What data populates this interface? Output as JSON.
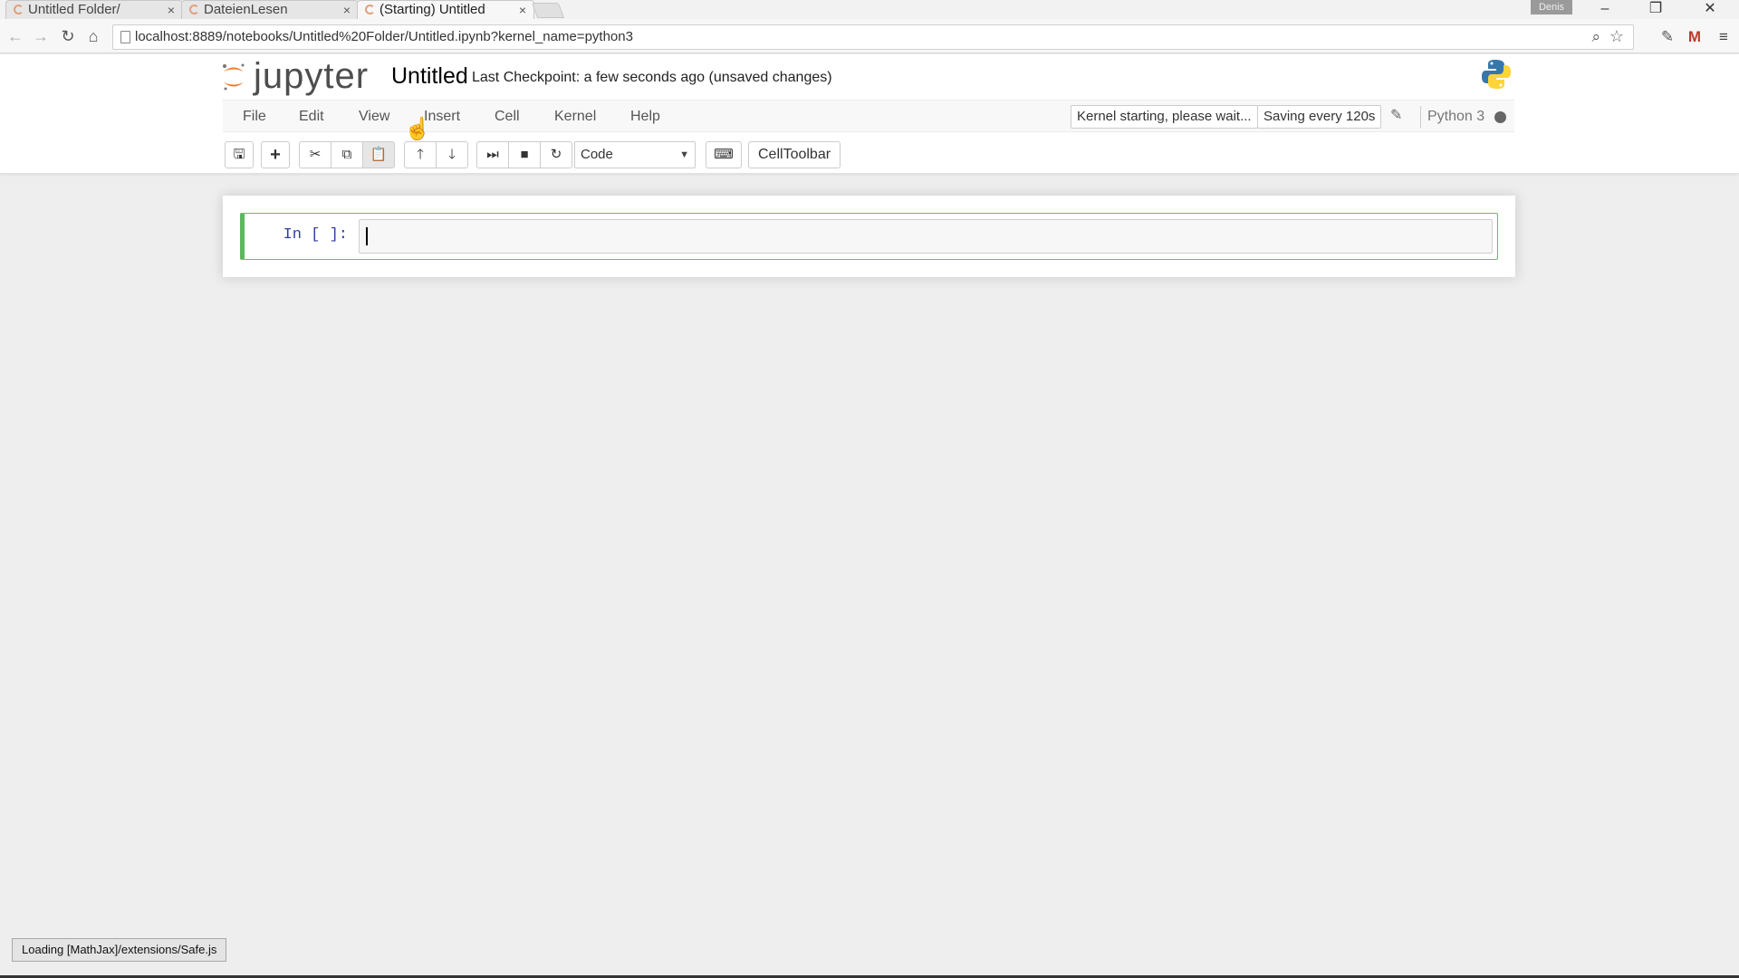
{
  "browser": {
    "tabs": [
      {
        "label": "Untitled Folder/",
        "close": "×"
      },
      {
        "label": "DateienLesen",
        "close": "×"
      },
      {
        "label": "(Starting) Untitled",
        "close": "×"
      }
    ],
    "profile": "Denis",
    "window_controls": {
      "minimize": "–",
      "restore": "❐",
      "close": "✕"
    },
    "url": "localhost:8889/notebooks/Untitled%20Folder/Untitled.ipynb?kernel_name=python3",
    "nav": {
      "back": "←",
      "forward": "→",
      "reload": "↻",
      "home": "⌂"
    }
  },
  "jupyter": {
    "logo_text": "jupyter",
    "notebook_title": "Untitled",
    "checkpoint": "Last Checkpoint: a few seconds ago (unsaved changes)",
    "menu": [
      "File",
      "Edit",
      "View",
      "Insert",
      "Cell",
      "Kernel",
      "Help"
    ],
    "kernel_status": "Kernel starting, please wait...",
    "autosave": "Saving every 120s",
    "kernel_name": "Python 3",
    "toolbar": {
      "save": "🖫",
      "insert": "+",
      "cut": "✂",
      "copy": "⧉",
      "paste": "📋",
      "move_up": "🡑",
      "move_down": "🡓",
      "run": "⏭",
      "stop": "■",
      "restart": "↻",
      "keyboard": "⌨",
      "celltype": "Code",
      "celltoolbar": "CellToolbar"
    },
    "cell": {
      "prompt": "In [ ]:",
      "source": ""
    }
  },
  "status_message": "Loading [MathJax]/extensions/Safe.js",
  "colors": {
    "cell_selected": "#5cb85c",
    "prompt": "#303f9f",
    "logo_orange": "#f37726"
  }
}
